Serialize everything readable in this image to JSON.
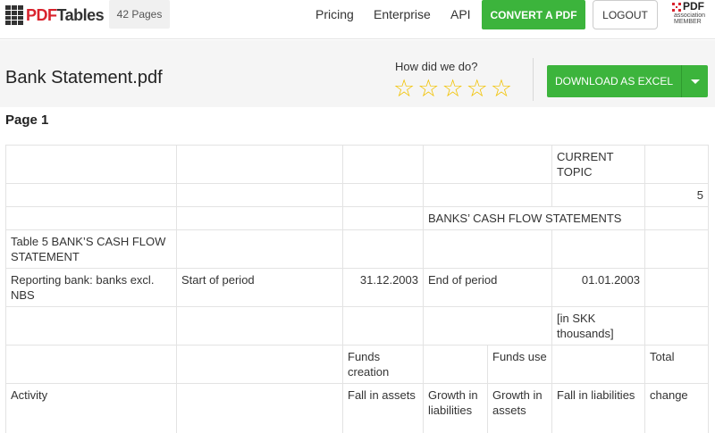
{
  "navbar": {
    "logo_pdf": "PDF",
    "logo_tables": "Tables",
    "pages_badge": "42 Pages",
    "links": {
      "pricing": "Pricing",
      "enterprise": "Enterprise",
      "api": "API"
    },
    "convert_label": "CONVERT A PDF",
    "logout_label": "LOGOUT",
    "pdfa_logo": {
      "big": "PDF",
      "small": "association MEMBER"
    }
  },
  "subheader": {
    "file_title": "Bank Statement.pdf",
    "rate_prompt": "How did we do?",
    "stars": 5,
    "download_label": "DOWNLOAD AS EXCEL"
  },
  "page_label": "Page 1",
  "colors": {
    "accent_green": "#3cb43c",
    "brand_red": "#d9232d",
    "star_yellow": "#f2c200"
  },
  "table": {
    "rows": [
      [
        "",
        "",
        "",
        "",
        "CURRENT TOPIC",
        ""
      ],
      [
        "",
        "",
        "",
        "",
        "",
        "5"
      ],
      [
        "",
        "",
        "",
        "BANKS’ CASH FLOW STATEMENTS",
        "",
        ""
      ],
      [
        "Table 5 BANK’S CASH FLOW STATEMENT",
        "",
        "",
        "",
        "",
        ""
      ],
      [
        "Reporting bank: banks excl. NBS",
        "Start of period",
        "31.12.2003",
        "End of period",
        "01.01.2003",
        ""
      ],
      [
        "",
        "",
        "",
        "",
        "[in SKK thousands]",
        ""
      ],
      [
        "",
        "",
        "Funds creation",
        "",
        "Funds use",
        "",
        "Total"
      ],
      [
        "Activity",
        "",
        "Fall in assets",
        "Growth in liabilities",
        "Growth in assets",
        "Fall in liabilities",
        "change"
      ]
    ]
  }
}
